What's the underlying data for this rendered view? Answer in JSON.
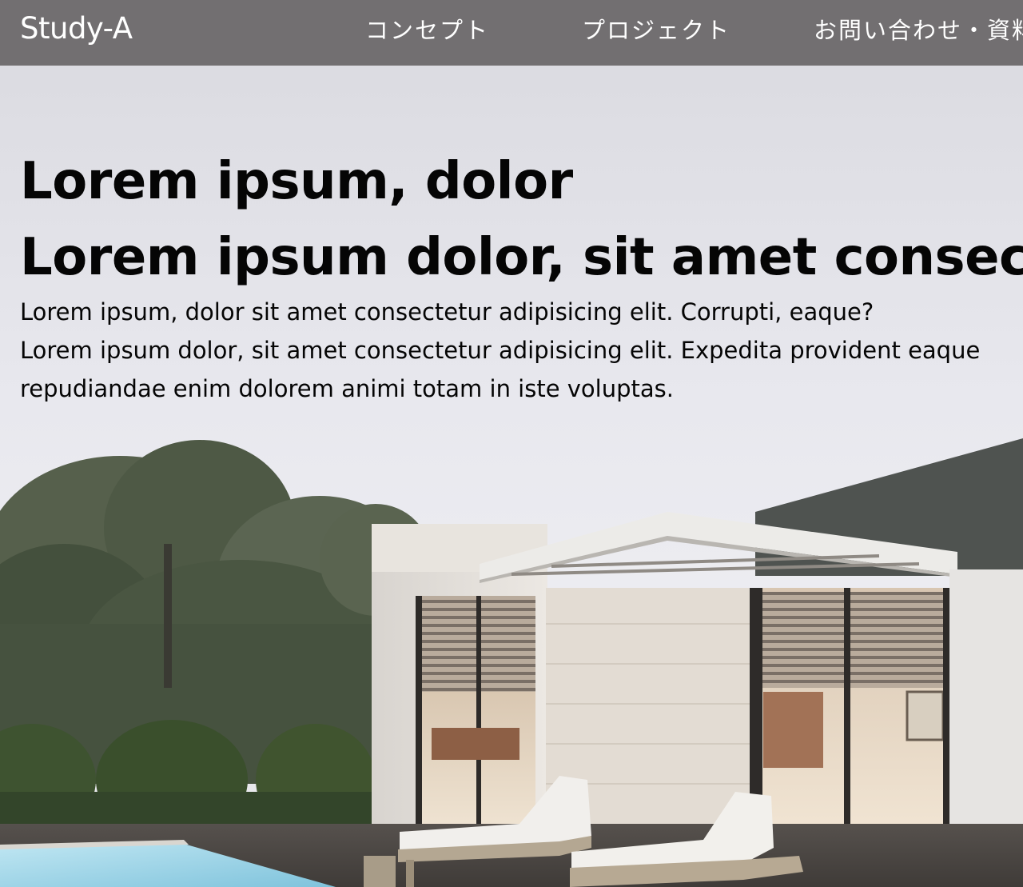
{
  "header": {
    "logo": "Study-A",
    "nav": [
      {
        "label": "コンセプト"
      },
      {
        "label": "プロジェクト"
      },
      {
        "label": "お問い合わせ・資料"
      }
    ],
    "background": "#696668"
  },
  "hero": {
    "title_lines": [
      "Lorem ipsum, dolor",
      "Lorem ipsum dolor, sit amet consectetur"
    ],
    "body_lines": [
      "Lorem ipsum, dolor sit amet consectetur adipisicing elit. Corrupti, eaque?",
      "Lorem ipsum dolor, sit amet consectetur adipisicing elit. Expedita provident eaque",
      "repudiandae enim dolorem animi totam in iste voluptas."
    ],
    "image_icon": "modern-house-photo",
    "text_color": "#050505"
  }
}
